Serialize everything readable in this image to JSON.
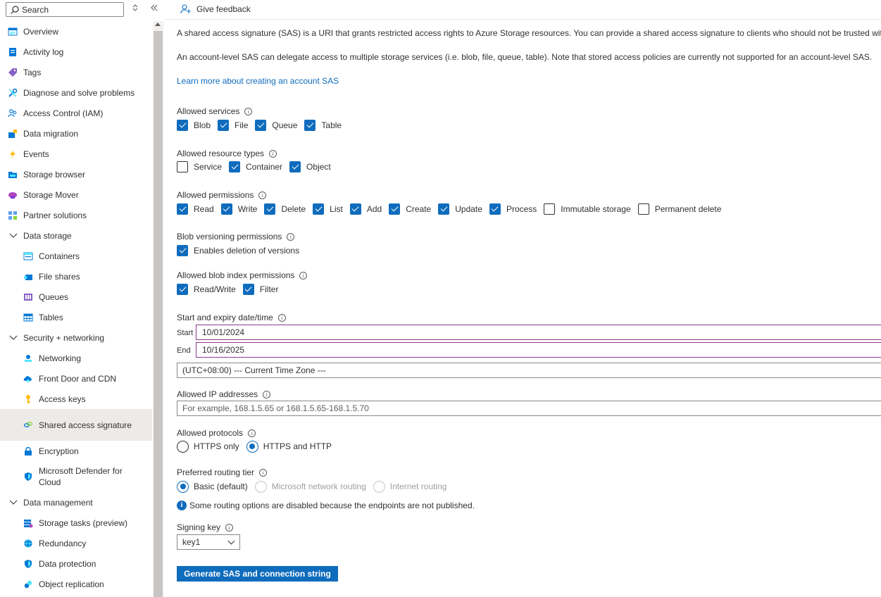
{
  "sidebar": {
    "search_placeholder": "Search",
    "items": [
      {
        "label": "Overview",
        "icon": "overview-icon"
      },
      {
        "label": "Activity log",
        "icon": "activity-log-icon"
      },
      {
        "label": "Tags",
        "icon": "tag-icon"
      },
      {
        "label": "Diagnose and solve problems",
        "icon": "wrench-icon"
      },
      {
        "label": "Access Control (IAM)",
        "icon": "people-icon"
      },
      {
        "label": "Data migration",
        "icon": "data-migration-icon"
      },
      {
        "label": "Events",
        "icon": "lightning-icon"
      },
      {
        "label": "Storage browser",
        "icon": "storage-browser-icon"
      },
      {
        "label": "Storage Mover",
        "icon": "storage-mover-icon"
      },
      {
        "label": "Partner solutions",
        "icon": "partner-icon"
      },
      {
        "label": "Data storage",
        "icon": "chevron-down-icon"
      },
      {
        "label": "Containers",
        "icon": "container-icon"
      },
      {
        "label": "File shares",
        "icon": "file-share-icon"
      },
      {
        "label": "Queues",
        "icon": "queue-icon"
      },
      {
        "label": "Tables",
        "icon": "table-icon"
      },
      {
        "label": "Security + networking",
        "icon": "chevron-down-icon"
      },
      {
        "label": "Networking",
        "icon": "network-icon"
      },
      {
        "label": "Front Door and CDN",
        "icon": "cloud-icon"
      },
      {
        "label": "Access keys",
        "icon": "key-icon"
      },
      {
        "label": "Shared access signature",
        "icon": "link-icon"
      },
      {
        "label": "Encryption",
        "icon": "lock-icon"
      },
      {
        "label": "Microsoft Defender for Cloud",
        "icon": "shield-icon"
      },
      {
        "label": "Data management",
        "icon": "chevron-down-icon"
      },
      {
        "label": "Storage tasks (preview)",
        "icon": "storage-tasks-icon"
      },
      {
        "label": "Redundancy",
        "icon": "globe-icon"
      },
      {
        "label": "Data protection",
        "icon": "shield-icon"
      },
      {
        "label": "Object replication",
        "icon": "replication-icon"
      }
    ]
  },
  "toolbar": {
    "feedback_label": "Give feedback"
  },
  "main": {
    "description1": "A shared access signature (SAS) is a URI that grants restricted access rights to Azure Storage resources. You can provide a shared access signature to clients who should not be trusted with your st",
    "description2": "An account-level SAS can delegate access to multiple storage services (i.e. blob, file, queue, table). Note that stored access policies are currently not supported for an account-level SAS.",
    "learn_more": "Learn more about creating an account SAS",
    "allowed_services": {
      "label": "Allowed services",
      "options": [
        {
          "label": "Blob",
          "checked": true
        },
        {
          "label": "File",
          "checked": true
        },
        {
          "label": "Queue",
          "checked": true
        },
        {
          "label": "Table",
          "checked": true
        }
      ]
    },
    "allowed_resource_types": {
      "label": "Allowed resource types",
      "options": [
        {
          "label": "Service",
          "checked": false
        },
        {
          "label": "Container",
          "checked": true
        },
        {
          "label": "Object",
          "checked": true
        }
      ]
    },
    "allowed_permissions": {
      "label": "Allowed permissions",
      "options": [
        {
          "label": "Read",
          "checked": true
        },
        {
          "label": "Write",
          "checked": true
        },
        {
          "label": "Delete",
          "checked": true
        },
        {
          "label": "List",
          "checked": true
        },
        {
          "label": "Add",
          "checked": true
        },
        {
          "label": "Create",
          "checked": true
        },
        {
          "label": "Update",
          "checked": true
        },
        {
          "label": "Process",
          "checked": true
        },
        {
          "label": "Immutable storage",
          "checked": false
        },
        {
          "label": "Permanent delete",
          "checked": false
        }
      ]
    },
    "blob_versioning": {
      "label": "Blob versioning permissions",
      "options": [
        {
          "label": "Enables deletion of versions",
          "checked": true
        }
      ]
    },
    "blob_index": {
      "label": "Allowed blob index permissions",
      "options": [
        {
          "label": "Read/Write",
          "checked": true
        },
        {
          "label": "Filter",
          "checked": true
        }
      ]
    },
    "dates": {
      "label": "Start and expiry date/time",
      "start_label": "Start",
      "start_value": "10/01/2024",
      "end_label": "End",
      "end_value": "10/16/2025",
      "timezone": "(UTC+08:00) --- Current Time Zone ---"
    },
    "ip": {
      "label": "Allowed IP addresses",
      "placeholder": "For example, 168.1.5.65 or 168.1.5.65-168.1.5.70",
      "value": ""
    },
    "protocols": {
      "label": "Allowed protocols",
      "options": [
        {
          "label": "HTTPS only",
          "checked": false,
          "disabled": false
        },
        {
          "label": "HTTPS and HTTP",
          "checked": true,
          "disabled": false
        }
      ]
    },
    "routing": {
      "label": "Preferred routing tier",
      "options": [
        {
          "label": "Basic (default)",
          "checked": true,
          "disabled": false
        },
        {
          "label": "Microsoft network routing",
          "checked": false,
          "disabled": true
        },
        {
          "label": "Internet routing",
          "checked": false,
          "disabled": true
        }
      ],
      "note": "Some routing options are disabled because the endpoints are not published."
    },
    "signing_key": {
      "label": "Signing key",
      "value": "key1"
    },
    "generate_button": "Generate SAS and connection string"
  },
  "colors": {
    "accent": "#0f6cbd",
    "selected_nav": "#edebe9",
    "date_border": "#8b3b8b"
  }
}
